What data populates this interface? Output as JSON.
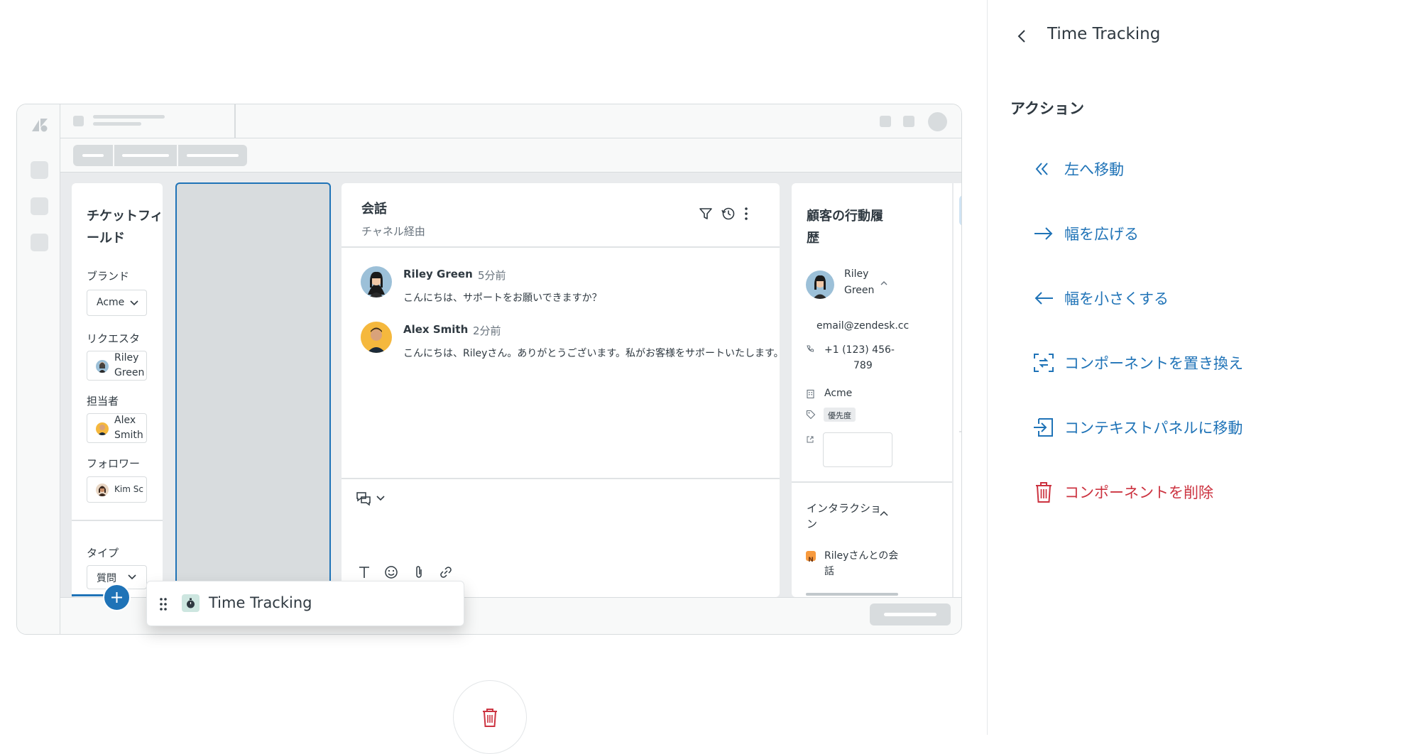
{
  "panel": {
    "title": "Time Tracking",
    "section_heading": "アクション",
    "actions": [
      {
        "label": "左へ移動",
        "icon": "double-chevron-left-icon",
        "variant": "primary"
      },
      {
        "label": "幅を広げる",
        "icon": "arrow-right-icon",
        "variant": "primary"
      },
      {
        "label": "幅を小さくする",
        "icon": "arrow-left-icon",
        "variant": "primary"
      },
      {
        "label": "コンポーネントを置き換え",
        "icon": "replace-icon",
        "variant": "primary"
      },
      {
        "label": "コンテキストパネルに移動",
        "icon": "move-to-panel-icon",
        "variant": "primary"
      },
      {
        "label": "コンポーネントを削除",
        "icon": "trash-icon",
        "variant": "danger"
      }
    ]
  },
  "ticket_fields": {
    "title_line1": "チケットフィ",
    "title_line2": "ールド",
    "brand_label": "ブランド",
    "brand_value": "Acme",
    "requester_label": "リクエスタ",
    "requester_line1": "Riley",
    "requester_line2": "Green",
    "assignee_label": "担当者",
    "assignee_line1": "Alex",
    "assignee_line2": "Smith",
    "followers_label": "フォロワー",
    "follower_value": "Kim Sc",
    "type_label": "タイプ",
    "type_value": "質問"
  },
  "conversation": {
    "title": "会話",
    "subtitle": "チャネル経由",
    "messages": [
      {
        "author": "Riley Green",
        "time": "5分前",
        "text": "こんにちは、サポートをお願いできますか？"
      },
      {
        "author": "Alex Smith",
        "time": "2分前",
        "text": "こんにちは、Rileyさん。ありがとうございます。私がお客様をサポートいたします。"
      }
    ]
  },
  "customer": {
    "title_line1": "顧客の行動履",
    "title_line2": "歴",
    "name_line1": "Riley",
    "name_line2": "Green",
    "email": "email@zendesk.cc",
    "phone_line1": "+1 (123) 456-",
    "phone_line2": "789",
    "org": "Acme",
    "tag": "優先度",
    "interactions_title_line1": "インタラクショ",
    "interactions_title_line2": "ン",
    "interaction_badge": "N",
    "interaction_line1": "Rileyさんとの会",
    "interaction_line2": "話"
  },
  "drag_chip": {
    "label": "Time Tracking"
  },
  "colors": {
    "accent": "#1f73b7",
    "danger": "#cc3340",
    "work_bg": "#e9ebed",
    "placeholder": "#d8dcde"
  }
}
